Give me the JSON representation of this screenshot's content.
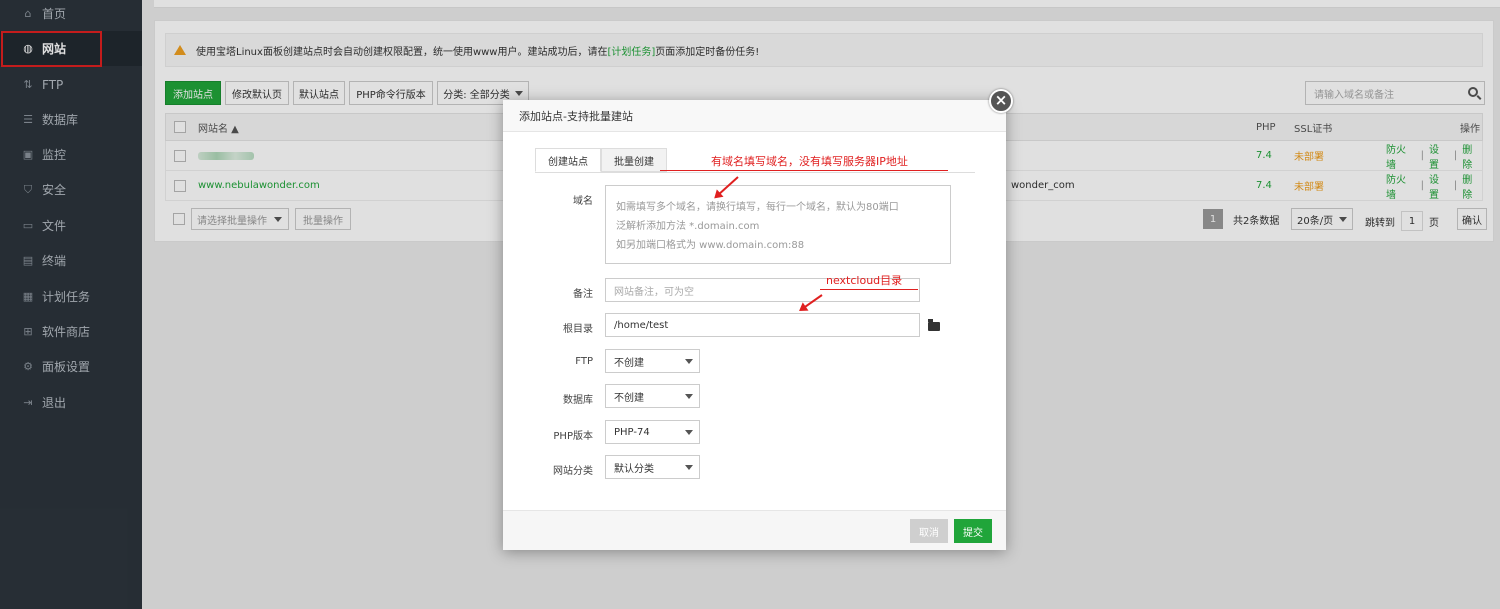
{
  "sidebar": {
    "items": [
      {
        "label": "首页",
        "icon": "home-icon"
      },
      {
        "label": "网站",
        "icon": "globe-icon"
      },
      {
        "label": "FTP",
        "icon": "ftp-icon"
      },
      {
        "label": "数据库",
        "icon": "database-icon"
      },
      {
        "label": "监控",
        "icon": "monitor-icon"
      },
      {
        "label": "安全",
        "icon": "shield-icon"
      },
      {
        "label": "文件",
        "icon": "folder-icon"
      },
      {
        "label": "终端",
        "icon": "terminal-icon"
      },
      {
        "label": "计划任务",
        "icon": "calendar-icon"
      },
      {
        "label": "软件商店",
        "icon": "grid-icon"
      },
      {
        "label": "面板设置",
        "icon": "gear-icon"
      },
      {
        "label": "退出",
        "icon": "logout-icon"
      }
    ],
    "active_index": 1
  },
  "notice": {
    "text_before": "使用宝塔Linux面板创建站点时会自动创建权限配置，统一使用www用户。建站成功后，请在",
    "link": "[计划任务]",
    "text_after": "页面添加定时备份任务!"
  },
  "toolbar": {
    "add_site": "添加站点",
    "edit_default_page": "修改默认页",
    "default_site": "默认站点",
    "php_cli_version": "PHP命令行版本",
    "category_filter": "分类: 全部分类",
    "search_placeholder": "请输入域名或备注"
  },
  "table": {
    "headers": {
      "site_name": "网站名 ▲",
      "php": "PHP",
      "ssl": "SSL证书",
      "actions": "操作"
    },
    "rows": [
      {
        "site": "",
        "remark": "",
        "php": "7.4",
        "ssl": "未部署",
        "actions": [
          "防火墙",
          "设置",
          "删除"
        ]
      },
      {
        "site": "www.nebulawonder.com",
        "remark": "wonder_com",
        "php": "7.4",
        "ssl": "未部署",
        "actions": [
          "防火墙",
          "设置",
          "删除"
        ]
      }
    ]
  },
  "footer": {
    "batch_select": "请选择批量操作",
    "batch_button": "批量操作",
    "current_page": "1",
    "total": "共2条数据",
    "per_page": "20条/页",
    "jump_label": "跳转到",
    "jump_value": "1",
    "page_unit": "页",
    "confirm": "确认"
  },
  "modal": {
    "title": "添加站点-支持批量建站",
    "close": "×",
    "tabs": [
      "创建站点",
      "批量创建"
    ],
    "fields": {
      "domain_label": "域名",
      "domain_placeholder_lines": [
        "如需填写多个域名，请换行填写，每行一个域名，默认为80端口",
        "泛解析添加方法 *.domain.com",
        "如另加端口格式为 www.domain.com:88"
      ],
      "remark_label": "备注",
      "remark_placeholder": "网站备注，可为空",
      "root_label": "根目录",
      "root_value": "/home/test",
      "ftp_label": "FTP",
      "ftp_value": "不创建",
      "db_label": "数据库",
      "db_value": "不创建",
      "php_label": "PHP版本",
      "php_value": "PHP-74",
      "category_label": "网站分类",
      "category_value": "默认分类"
    },
    "cancel": "取消",
    "submit": "提交"
  },
  "annotations": {
    "domain_note": "有域名填写域名，没有填写服务器IP地址",
    "root_note": "nextcloud目录"
  },
  "colors": {
    "accent": "#20a53a",
    "sidebar_bg": "#2c343c",
    "annotation": "#e02020",
    "warning": "#f0a020"
  }
}
